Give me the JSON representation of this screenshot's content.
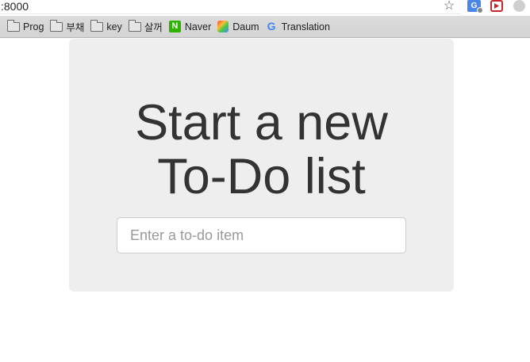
{
  "browser": {
    "url": ":8000",
    "bookmarks": [
      {
        "type": "folder",
        "label": "Prog"
      },
      {
        "type": "folder",
        "label": "부채"
      },
      {
        "type": "folder",
        "label": "key"
      },
      {
        "type": "folder",
        "label": "살꺼"
      },
      {
        "type": "site",
        "icon": "naver-icon",
        "label": "Naver"
      },
      {
        "type": "site",
        "icon": "daum-icon",
        "label": "Daum"
      },
      {
        "type": "site",
        "icon": "google-icon",
        "label": "Translation"
      }
    ],
    "toolbar_icons": [
      "star-icon",
      "translate-extension-icon",
      "red-extension-icon",
      "grey-extension-icon"
    ]
  },
  "page": {
    "heading_line1": "Start a new",
    "heading_line2": "To-Do list",
    "input_placeholder": "Enter a to-do item",
    "input_value": ""
  },
  "colors": {
    "jumbotron_bg": "#eeeeee",
    "heading": "#333333",
    "placeholder": "#999999"
  }
}
